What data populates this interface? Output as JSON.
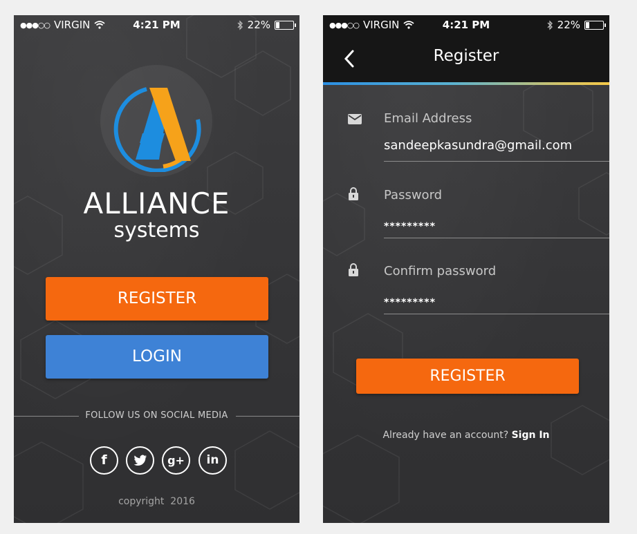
{
  "status_bar": {
    "signal_dots": "●●●○○",
    "carrier": "VIRGIN",
    "time": "4:21 PM",
    "battery": "22%",
    "battery_level": 0.22
  },
  "welcome": {
    "brand_line1": "ALLIANCE",
    "brand_line2": "systems",
    "register_label": "REGISTER",
    "login_label": "LOGIN",
    "follow_text": "FOLLOW US ON SOCIAL MEDIA",
    "social": [
      {
        "name": "facebook",
        "glyph": "f"
      },
      {
        "name": "twitter",
        "glyph": "t"
      },
      {
        "name": "google-plus",
        "glyph": "g+"
      },
      {
        "name": "linkedin",
        "glyph": "in"
      }
    ],
    "copyright": "copyright  2016"
  },
  "register": {
    "title": "Register",
    "email_label": "Email Address",
    "email_value": "sandeepkasundra@gmail.com",
    "password_label": "Password",
    "password_value": "*********",
    "confirm_label": "Confirm password",
    "confirm_value": "*********",
    "register_label": "REGISTER",
    "already_text": "Already have an account?",
    "sign_in_label": "Sign In"
  },
  "colors": {
    "orange": "#f5680f",
    "blue": "#3e82d6",
    "logo_blue": "#1d8ddf",
    "logo_orange": "#f6a21a",
    "background": "#3a3a3c"
  },
  "icons": [
    "wifi-icon",
    "bluetooth-icon",
    "battery-icon",
    "back-chevron-icon",
    "envelope-icon",
    "lock-icon"
  ]
}
